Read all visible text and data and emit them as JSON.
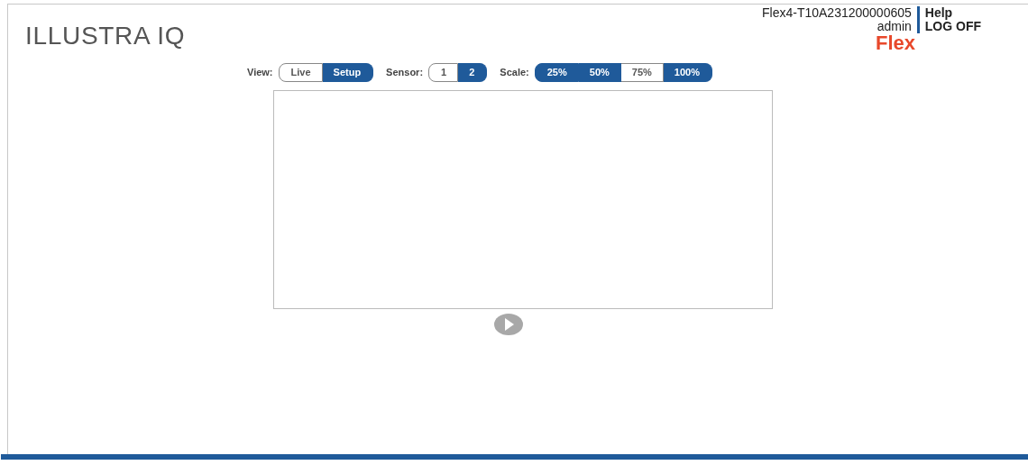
{
  "app_title": "ILLUSTRA IQ",
  "header": {
    "device_name": "Flex4-T10A231200000605",
    "user": "admin",
    "links": [
      "Help",
      "LOG OFF"
    ],
    "brand": "Flex"
  },
  "controls": [
    {
      "label": "View:",
      "options": [
        {
          "label": "Live",
          "selected": false
        },
        {
          "label": "Setup",
          "selected": true
        }
      ]
    },
    {
      "label": "Sensor:",
      "options": [
        {
          "label": "1",
          "selected": false
        },
        {
          "label": "2",
          "selected": true
        }
      ]
    },
    {
      "label": "Scale:",
      "options": [
        {
          "label": "25%",
          "selected": true
        },
        {
          "label": "50%",
          "selected": true
        },
        {
          "label": "75%",
          "selected": false
        },
        {
          "label": "100%",
          "selected": true
        }
      ]
    }
  ]
}
